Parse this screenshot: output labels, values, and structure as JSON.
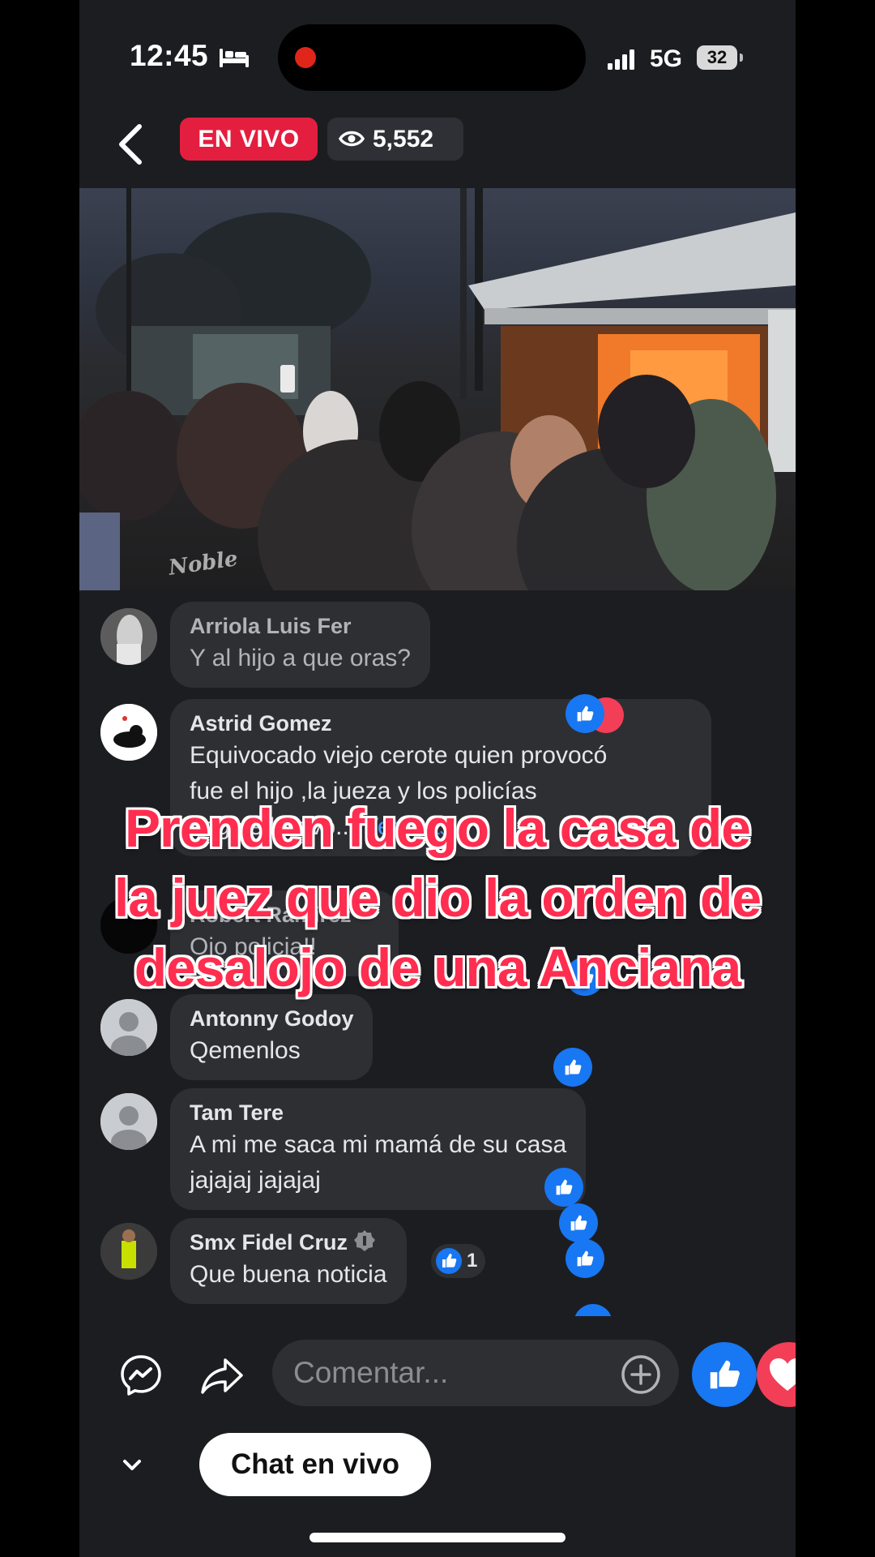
{
  "status_bar": {
    "time": "12:45",
    "network": "5G",
    "battery": "32",
    "icons": [
      "bed-icon",
      "signal-icon"
    ]
  },
  "live_header": {
    "badge": "EN VIVO",
    "viewers": "5,552",
    "icons": [
      "back-icon",
      "eye-icon"
    ]
  },
  "video": {
    "watermark": "Noble"
  },
  "comments": [
    {
      "name": "Arriola Luis Fer",
      "text": "Y al hijo a que oras?"
    },
    {
      "name": "Astrid Gomez",
      "lines": [
        "Equivocado viejo cerote quien provocó",
        "fue el hijo ,la jueza y los policías",
        "hagale huevo..."
      ],
      "see_more": "Ver más"
    },
    {
      "name": "Robert Ramirez",
      "text": "Ojo policia!!"
    },
    {
      "name": "Antonny Godoy",
      "text": "Qemenlos"
    },
    {
      "name": "Tam Tere",
      "lines": [
        "A mi me saca mi mamá de su casa",
        "jajajaj jajajaj"
      ]
    },
    {
      "name": "Smx Fidel Cruz",
      "text": "Que buena noticia",
      "reactions": "1"
    }
  ],
  "overlay_caption": {
    "lines": [
      "Prenden fuego la casa de",
      "la juez que dio la orden de",
      "desalojo de una Anciana"
    ]
  },
  "composer": {
    "placeholder": "Comentar...",
    "icons": [
      "messenger-icon",
      "share-icon",
      "add-icon",
      "like-icon",
      "heart-icon"
    ]
  },
  "bottom": {
    "chat_label": "Chat en vivo",
    "icons": [
      "chevron-down-icon"
    ]
  },
  "colors": {
    "background": "#1c1d21",
    "bubble": "#2e2f33",
    "live_red": "#e41e3f",
    "facebook_blue": "#1877f2",
    "love_red": "#f33e58",
    "caption_red": "#ff2d4f"
  }
}
